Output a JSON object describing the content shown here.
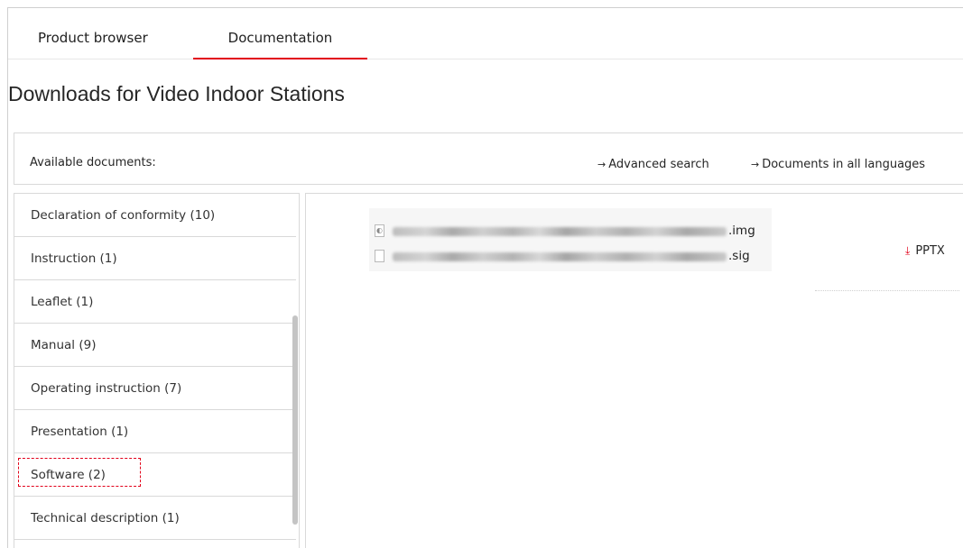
{
  "tabs": [
    {
      "label": "Product browser",
      "active": false
    },
    {
      "label": "Documentation",
      "active": true
    }
  ],
  "page_title": "Downloads for Video Indoor Stations",
  "docs_header": {
    "available_label": "Available documents:",
    "advanced_search": "Advanced search",
    "all_languages": "Documents in all languages",
    "link_arrow": "→"
  },
  "categories": [
    {
      "label": "Declaration of conformity (10)"
    },
    {
      "label": "Instruction (1)"
    },
    {
      "label": "Leaflet (1)"
    },
    {
      "label": "Manual (9)"
    },
    {
      "label": "Operating instruction (7)"
    },
    {
      "label": "Presentation (1)"
    },
    {
      "label": "Software (2)",
      "highlighted": true
    },
    {
      "label": "Technical description (1)"
    }
  ],
  "files": [
    {
      "ext": ".img",
      "icon": "disk-image-icon"
    },
    {
      "ext": ".sig",
      "icon": "blank-file-icon"
    }
  ],
  "download": {
    "label": "PPTX",
    "icon": "download-arrow-icon"
  },
  "colors": {
    "accent": "#e2001a",
    "border": "#d9d9d9"
  }
}
